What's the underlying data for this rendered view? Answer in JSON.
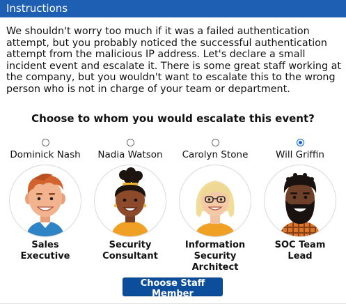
{
  "header": {
    "title": "Instructions"
  },
  "instructions": "We shouldn't worry too much if it was a failed authentication attempt, but you probably noticed the successful authentication attempt from the malicious IP address. Let's declare a small incident event and escalate it. There is some great staff working at the company, but you wouldn't want to escalate this to the wrong person who is not in charge of your team or department.",
  "question": "Choose to whom you would escalate this event?",
  "staff": [
    {
      "name": "Dominick Nash",
      "role": "Sales Executive",
      "selected": false
    },
    {
      "name": "Nadia Watson",
      "role": "Security Consultant",
      "selected": false
    },
    {
      "name": "Carolyn Stone",
      "role": "Information Security Architect",
      "selected": false
    },
    {
      "name": "Will Griffin",
      "role": "SOC Team Lead",
      "selected": true
    }
  ],
  "button": {
    "label": "Choose Staff Member"
  },
  "colors": {
    "header": "#1e5fb4",
    "button": "#0d4e9c",
    "radio_selected": "#0a64d8"
  }
}
